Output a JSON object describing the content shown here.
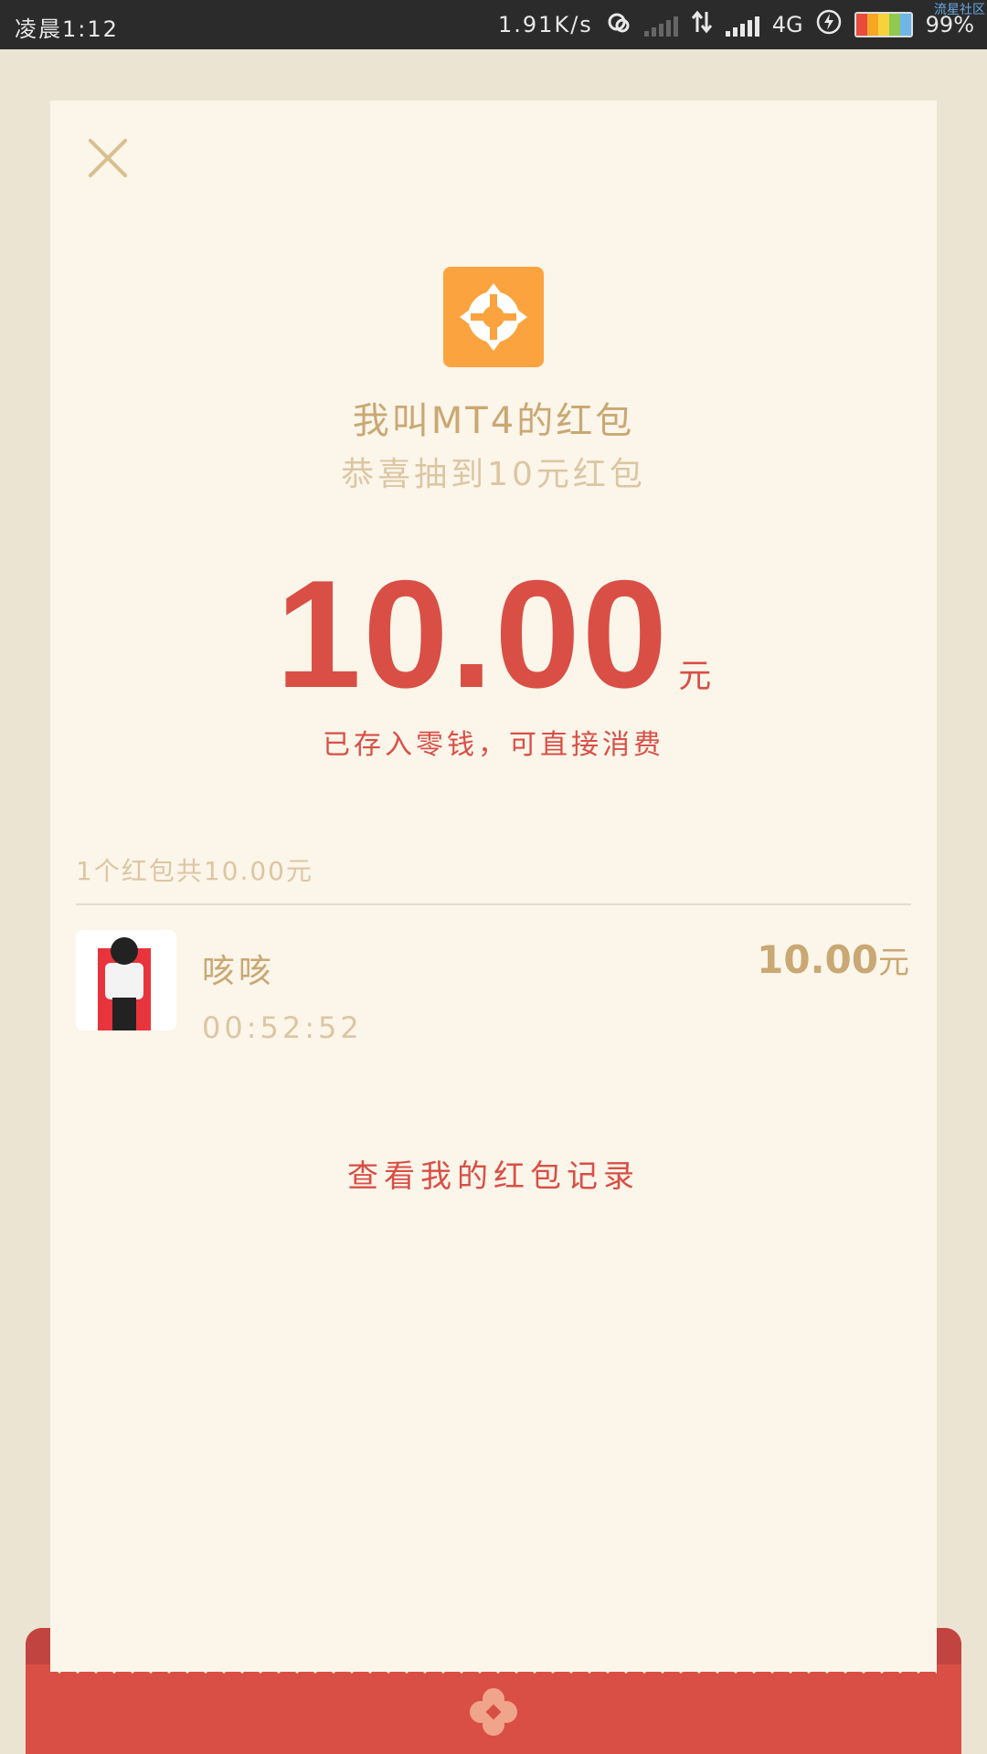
{
  "status_bar": {
    "time": "凌晨1:12",
    "speed": "1.91K/s",
    "network": "4G",
    "battery": "99%",
    "watermark": "流星社区"
  },
  "card": {
    "sender_name": "我叫MT4的红包",
    "greeting": "恭喜抽到10元红包",
    "amount": "10.00",
    "amount_unit": "元",
    "saved_note": "已存入零钱，可直接消费",
    "summary": "1个红包共10.00元",
    "recipient": {
      "name": "咳咳",
      "time": "00:52:52",
      "amount": "10.00",
      "unit": "元"
    },
    "history_link": "查看我的红包记录"
  },
  "colors": {
    "accent_red": "#d94f45",
    "gold": "#c9a873",
    "light_gold": "#dcc6a2",
    "app_icon_orange": "#fba43f",
    "card_bg": "#fbf5ea"
  }
}
